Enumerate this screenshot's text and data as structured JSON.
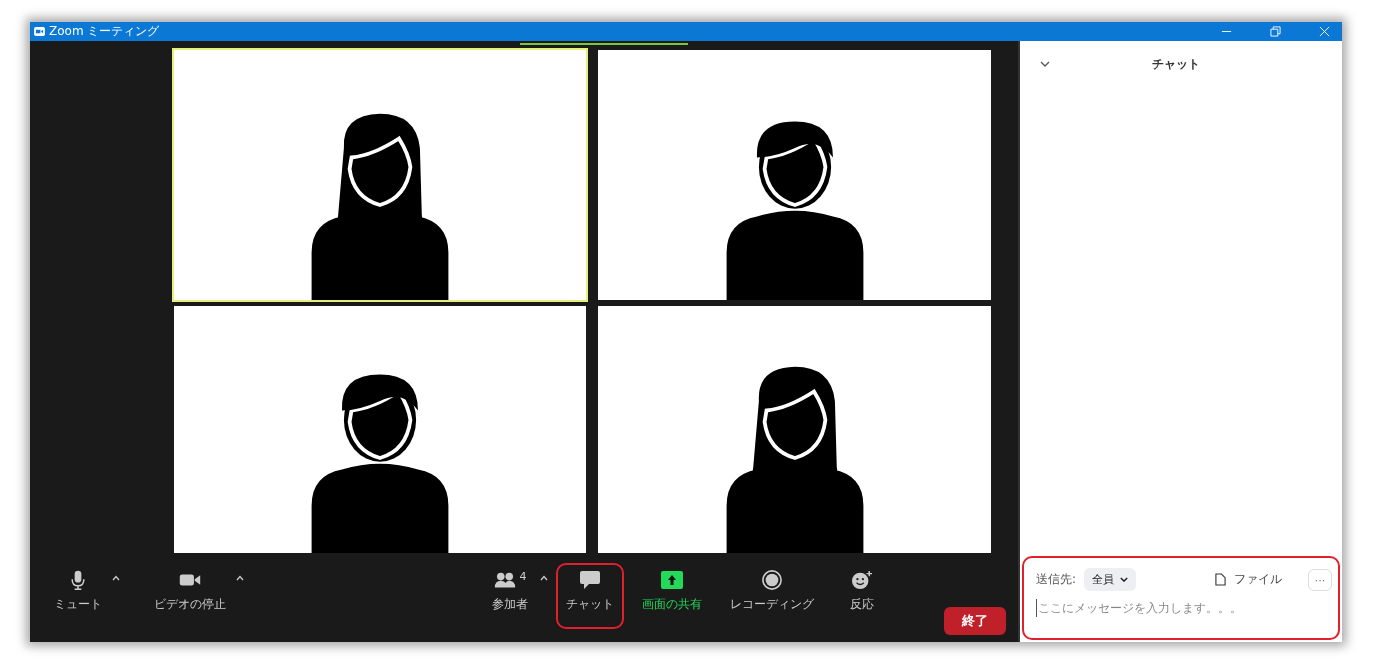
{
  "window": {
    "title": "Zoom ミーティング"
  },
  "participants": [
    {
      "kind": "long-hair",
      "selected": true
    },
    {
      "kind": "short-hair",
      "selected": false
    },
    {
      "kind": "short-hair",
      "selected": false
    },
    {
      "kind": "long-hair",
      "selected": false
    }
  ],
  "toolbar": {
    "left": [
      {
        "kind": "mic",
        "label": "ミュート",
        "caret": true
      },
      {
        "kind": "camera",
        "label": "ビデオの停止",
        "caret": true
      }
    ],
    "center": [
      {
        "kind": "participants",
        "label": "参加者",
        "count": "4",
        "caret": true,
        "highlighted": false
      },
      {
        "kind": "chat",
        "label": "チャット",
        "caret": false,
        "highlighted": true
      },
      {
        "kind": "share",
        "label": "画面の共有",
        "caret": false,
        "highlighted": false
      },
      {
        "kind": "record",
        "label": "レコーディング",
        "caret": false,
        "highlighted": false
      },
      {
        "kind": "reaction",
        "label": "反応",
        "caret": false,
        "highlighted": false
      }
    ],
    "end_button": "終了"
  },
  "chat_panel": {
    "title": "チャット",
    "highlighted": true,
    "to_label": "送信先:",
    "recipient": "全員",
    "file_button": "ファイル",
    "more_button": "···",
    "placeholder": "ここにメッセージを入力します。。。"
  }
}
